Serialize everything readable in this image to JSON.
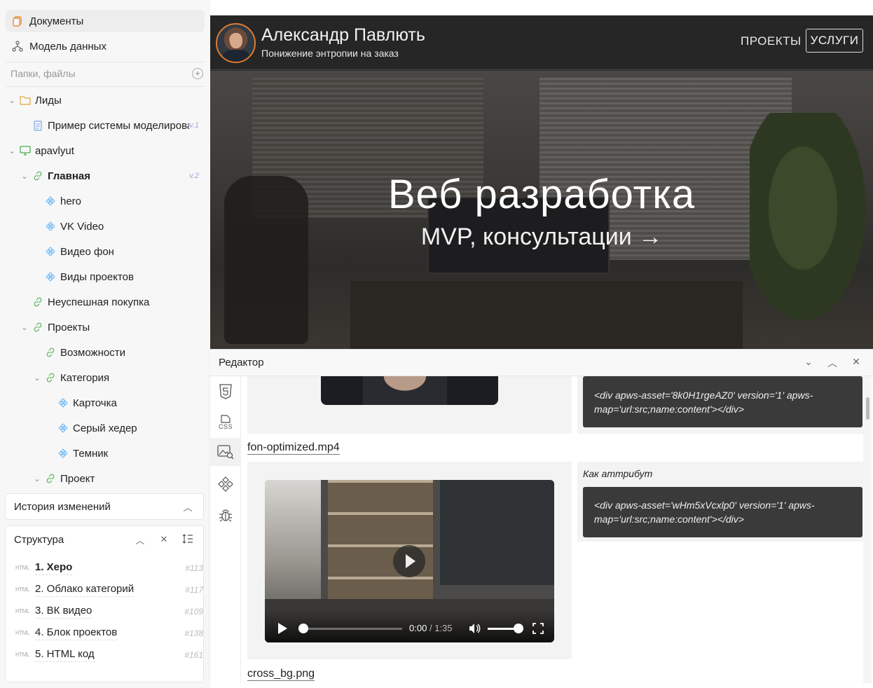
{
  "nav": {
    "documents": "Документы",
    "data_model": "Модель данных"
  },
  "files": {
    "label": "Папки, файлы"
  },
  "tree": [
    {
      "label": "Лиды"
    },
    {
      "label": "Пример системы моделирования",
      "version": "v.1"
    },
    {
      "label": "apavlyut"
    },
    {
      "label": "Главная",
      "version": "v.2"
    },
    {
      "label": "hero"
    },
    {
      "label": "VK Video"
    },
    {
      "label": "Видео фон"
    },
    {
      "label": "Виды проектов"
    },
    {
      "label": "Неуспешная покупка"
    },
    {
      "label": "Проекты"
    },
    {
      "label": "Возможности"
    },
    {
      "label": "Категория"
    },
    {
      "label": "Карточка"
    },
    {
      "label": "Серый хедер"
    },
    {
      "label": "Темник"
    },
    {
      "label": "Проект"
    }
  ],
  "history": {
    "title": "История изменений"
  },
  "structure": {
    "title": "Структура",
    "tag": "HTML",
    "items": [
      {
        "label": "1. Херо",
        "id": "#113"
      },
      {
        "label": "2. Облако категорий",
        "id": "#117"
      },
      {
        "label": "3. ВК видео",
        "id": "#109"
      },
      {
        "label": "4. Блок проектов",
        "id": "#138"
      },
      {
        "label": "5. HTML код",
        "id": "#161"
      }
    ]
  },
  "preview": {
    "name": "Александр Павлють",
    "tagline": "Понижение энтропии на заказ",
    "nav_projects": "ПРОЕКТЫ",
    "nav_services": "УСЛУГИ",
    "hero_title": "Веб разработка",
    "hero_sub": "MVP, консультации →"
  },
  "editor": {
    "title": "Редактор",
    "code1": "<div apws-asset='8k0H1rgeAZ0' version='1' apws-map='url:src;name:content'></div>",
    "file1": "fon-optimized.mp4",
    "attr_label": "Как аттрибут",
    "code2": "<div apws-asset='wHm5xVcxlp0' version='1' apws-map='url:src;name:content'></div>",
    "video_time": "0:00",
    "video_sep": "/",
    "video_duration": "1:35",
    "file2": "cross_bg.png",
    "rail_css": "CSS"
  }
}
